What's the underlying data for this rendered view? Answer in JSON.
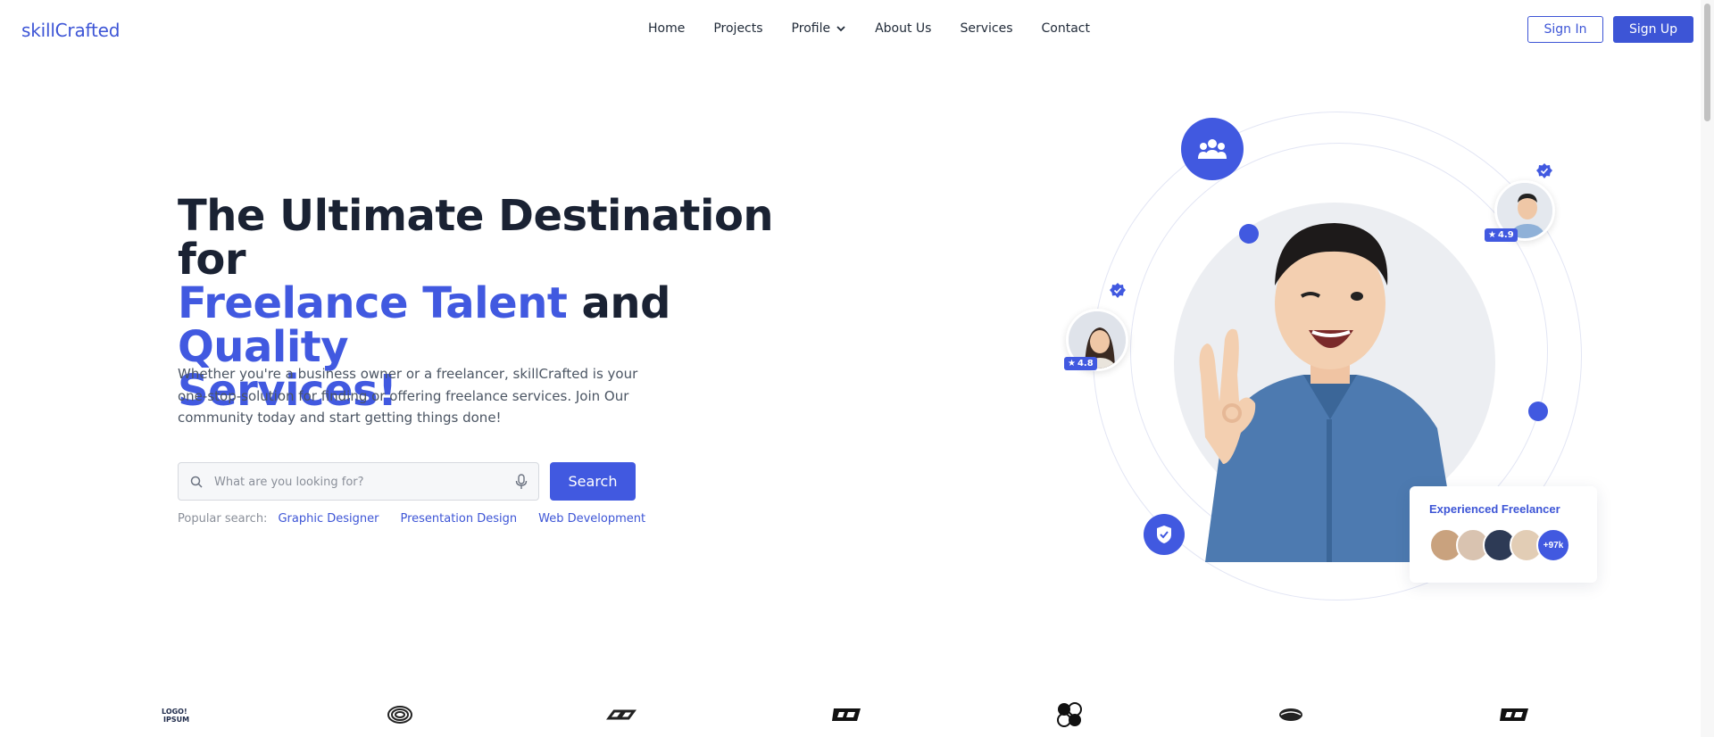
{
  "nav": {
    "brand": "skillCrafted",
    "items": [
      {
        "label": "Home"
      },
      {
        "label": "Projects"
      },
      {
        "label": "Profile"
      },
      {
        "label": "About Us"
      },
      {
        "label": "Services"
      },
      {
        "label": "Contact"
      }
    ],
    "signin_label": "Sign In",
    "signup_label": "Sign Up"
  },
  "hero": {
    "title_line1": "The Ultimate Destination for",
    "title_blue1": "Freelance Talent",
    "title_mid": " and ",
    "title_blue2": "Quality",
    "title_blue3": "Services!",
    "description": "Whether you're a business owner or a freelancer, skillCrafted is your one-stop-solution for finding or offering freelance services. Join Our community today and start getting things done!",
    "search_placeholder": "What are you looking for?",
    "search_value": "",
    "search_button": "Search",
    "popular_label": "Popular search:",
    "popular_tags": [
      "Graphic Designer",
      "Presentation Design",
      "Web Development"
    ]
  },
  "illustration": {
    "rating_left": "4.8",
    "rating_right": "4.9",
    "card_title": "Experienced Freelancer",
    "card_count": "+97k"
  },
  "colors": {
    "accent": "#4159e0",
    "brand": "#3d55d6",
    "text": "#1a2233"
  },
  "logos": [
    "logoipsum-logo",
    "spiral-logo",
    "chain-logo",
    "bracket-logo",
    "circles-logo",
    "eye-logo",
    "bracket-logo"
  ]
}
